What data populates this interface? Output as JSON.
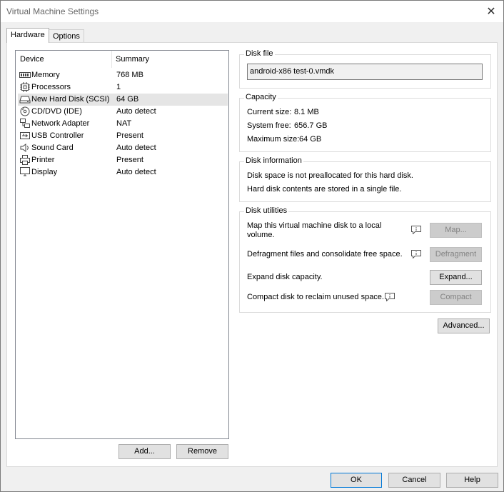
{
  "window": {
    "title": "Virtual Machine Settings",
    "close_glyph": "✕"
  },
  "tabs": [
    {
      "label": "Hardware",
      "active": true
    },
    {
      "label": "Options",
      "active": false
    }
  ],
  "device_list": {
    "headers": {
      "device": "Device",
      "summary": "Summary"
    },
    "rows": [
      {
        "icon": "memory-icon",
        "device": "Memory",
        "summary": "768 MB",
        "selected": false
      },
      {
        "icon": "processor-icon",
        "device": "Processors",
        "summary": "1",
        "selected": false
      },
      {
        "icon": "hard-disk-icon",
        "device": "New Hard Disk (SCSI)",
        "summary": "64 GB",
        "selected": true
      },
      {
        "icon": "cd-dvd-icon",
        "device": "CD/DVD (IDE)",
        "summary": "Auto detect",
        "selected": false
      },
      {
        "icon": "network-adapter-icon",
        "device": "Network Adapter",
        "summary": "NAT",
        "selected": false
      },
      {
        "icon": "usb-icon",
        "device": "USB Controller",
        "summary": "Present",
        "selected": false
      },
      {
        "icon": "sound-card-icon",
        "device": "Sound Card",
        "summary": "Auto detect",
        "selected": false
      },
      {
        "icon": "printer-icon",
        "device": "Printer",
        "summary": "Present",
        "selected": false
      },
      {
        "icon": "display-icon",
        "device": "Display",
        "summary": "Auto detect",
        "selected": false
      }
    ],
    "add_label": "Add...",
    "remove_label": "Remove"
  },
  "disk_file": {
    "title": "Disk file",
    "value": "android-x86 test-0.vmdk"
  },
  "capacity": {
    "title": "Capacity",
    "current_label": "Current size:",
    "current_value": "8.1 MB",
    "free_label": "System free:",
    "free_value": "656.7 GB",
    "max_label": "Maximum size:",
    "max_value": "64 GB"
  },
  "disk_information": {
    "title": "Disk information",
    "line1": "Disk space is not preallocated for this hard disk.",
    "line2": "Hard disk contents are stored in a single file."
  },
  "disk_utilities": {
    "title": "Disk utilities",
    "map_text_1": "Map this virtual machine disk to a local",
    "map_text_2": "volume.",
    "map_button": "Map...",
    "defrag_text": "Defragment files and consolidate free space.",
    "defrag_button": "Defragment",
    "expand_text": "Expand disk capacity.",
    "expand_button": "Expand...",
    "compact_text": "Compact disk to reclaim unused space.",
    "compact_button": "Compact"
  },
  "advanced_label": "Advanced...",
  "footer": {
    "ok_label": "OK",
    "cancel_label": "Cancel",
    "help_label": "Help"
  },
  "colors": {
    "selected_row": "#e5e5e5",
    "default_button_border": "#0078d7",
    "disabled_text": "#838383"
  }
}
